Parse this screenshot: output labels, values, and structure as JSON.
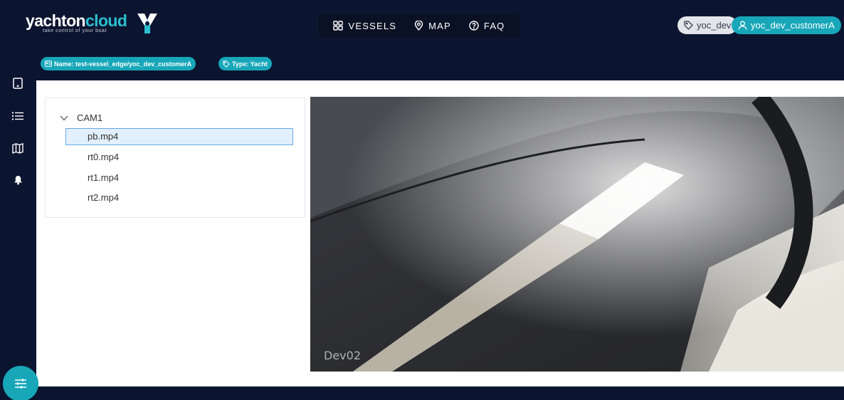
{
  "brand": {
    "name_part1": "yachton",
    "name_part2": "cloud",
    "tagline": "take control of your boat",
    "accent_color": "#2bc0d0"
  },
  "nav": {
    "items": [
      {
        "label": "VESSELS",
        "icon": "grid-icon"
      },
      {
        "label": "MAP",
        "icon": "map-pin-icon"
      },
      {
        "label": "FAQ",
        "icon": "question-circle-icon"
      }
    ]
  },
  "account": {
    "environment": "yoc_dev",
    "user": "yoc_dev_customerA"
  },
  "vessel": {
    "name_badge": "Name: test-vessel_edge/yoc_dev_customerA",
    "type_badge": "Type: Yacht"
  },
  "sidebar": {
    "items": [
      {
        "icon": "tablet-icon"
      },
      {
        "icon": "list-icon"
      },
      {
        "icon": "map-icon"
      },
      {
        "icon": "bell-icon"
      }
    ]
  },
  "file_tree": {
    "folder": "CAM1",
    "files": [
      "pb.mp4",
      "rt0.mp4",
      "rt1.mp4",
      "rt2.mp4"
    ],
    "selected": "pb.mp4"
  },
  "video": {
    "overlay_label": "Dev02"
  },
  "fab": {
    "icon": "sliders-icon"
  },
  "colors": {
    "background": "#0c1530",
    "accent": "#18a7b9",
    "selection": "#e2effd"
  }
}
